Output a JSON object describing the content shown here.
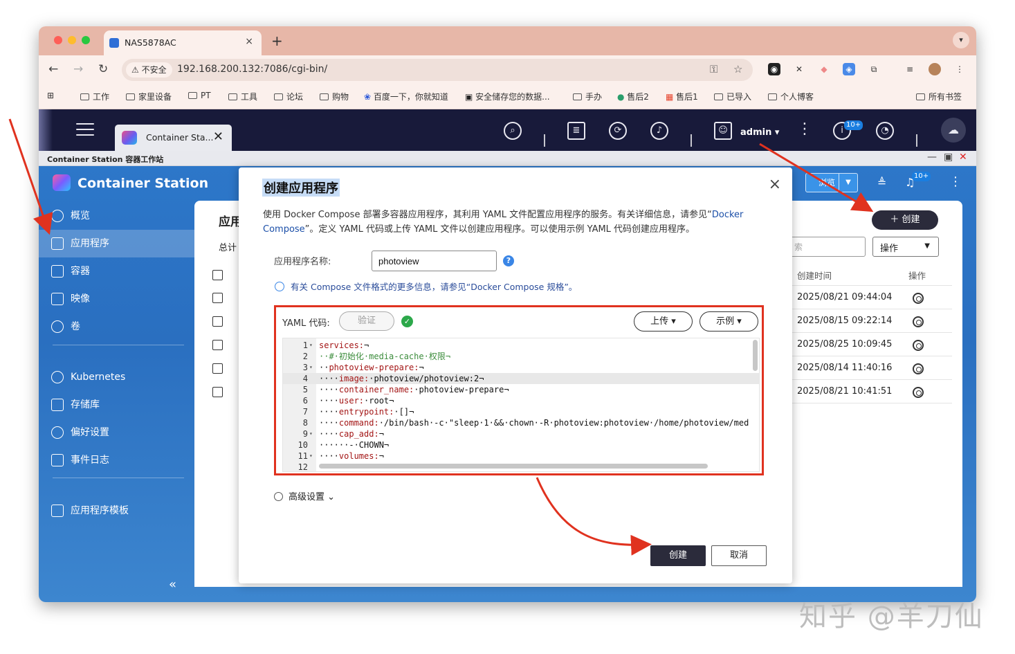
{
  "browser": {
    "tab_title": "NAS5878AC",
    "tab_close": "×",
    "new_tab": "+",
    "insecure_label": "不安全",
    "url": "192.168.200.132:7086/cgi-bin/",
    "bookmarks": [
      "工作",
      "家里设备",
      "PT",
      "工具",
      "论坛",
      "购物",
      "百度一下，你就知道",
      "安全储存您的数据...",
      "手办",
      "售后2",
      "售后1",
      "已导入",
      "个人博客",
      "所有书签"
    ]
  },
  "qts": {
    "app_tab_label": "Container Sta...",
    "app_tab_close": "✕",
    "user": "admin ▾",
    "notif_badge": "10+"
  },
  "window_strip": {
    "title": "Container Station 容器工作站"
  },
  "app": {
    "brand": "Container Station",
    "sidebar": [
      {
        "label": "概览"
      },
      {
        "label": "应用程序"
      },
      {
        "label": "容器"
      },
      {
        "label": "映像"
      },
      {
        "label": "卷"
      },
      {
        "label": "Kubernetes"
      },
      {
        "label": "存储库"
      },
      {
        "label": "偏好设置"
      },
      {
        "label": "事件日志"
      },
      {
        "label": "应用程序模板"
      }
    ],
    "collapse": "«",
    "main_title": "应用",
    "main_total": "总计",
    "browse_label": "浏览",
    "header_badge": "10+",
    "create_button": "＋ 创建",
    "search_placeholder": "索",
    "ops_select": "操作",
    "col_created": "创建时间",
    "col_ops": "操作",
    "rows": [
      {
        "created": "2025/08/21 09:44:04"
      },
      {
        "created": "2025/08/15 09:22:14"
      },
      {
        "created": "2025/08/25 10:09:45"
      },
      {
        "created": "2025/08/14 11:40:16"
      },
      {
        "created": "2025/08/21 10:41:51"
      }
    ]
  },
  "modal": {
    "title": "创建应用程序",
    "close": "×",
    "desc_before": "使用 Docker Compose 部署多容器应用程序，其利用 YAML 文件配置应用程序的服务。有关详细信息，请参见“",
    "desc_link": "Docker Compose",
    "desc_after": "”。定义 YAML 代码或上传 YAML 文件以创建应用程序。可以使用示例 YAML 代码创建应用程序。",
    "name_label": "应用程序名称:",
    "name_value": "photoview",
    "help": "?",
    "info_text": "有关 Compose 文件格式的更多信息，请参见“Docker Compose 规格”。",
    "yaml_label": "YAML 代码:",
    "verify_label": "验证",
    "upload_label": "上传 ▾",
    "example_label": "示例 ▾",
    "code_lines": [
      {
        "n": "1",
        "fold": "▾",
        "text": "services:¬"
      },
      {
        "n": "2",
        "fold": "",
        "text": "··#·初始化·media-cache·权限¬"
      },
      {
        "n": "3",
        "fold": "▾",
        "text": "··photoview-prepare:¬"
      },
      {
        "n": "4",
        "fold": "",
        "text": "····image:·photoview/photoview:2¬"
      },
      {
        "n": "5",
        "fold": "",
        "text": "····container_name:·photoview-prepare¬"
      },
      {
        "n": "6",
        "fold": "",
        "text": "····user:·root¬"
      },
      {
        "n": "7",
        "fold": "",
        "text": "····entrypoint:·[]¬"
      },
      {
        "n": "8",
        "fold": "",
        "text": "····command:·/bin/bash·-c·\"sleep·1·&&·chown·-R·photoview:photoview·/home/photoview/med"
      },
      {
        "n": "9",
        "fold": "▾",
        "text": "····cap_add:¬"
      },
      {
        "n": "10",
        "fold": "",
        "text": "······-·CHOWN¬"
      },
      {
        "n": "11",
        "fold": "▾",
        "text": "····volumes:¬"
      },
      {
        "n": "12",
        "fold": "",
        "text": ""
      }
    ],
    "advanced_label": "高级设置",
    "create_label": "创建",
    "cancel_label": "取消"
  },
  "watermark": "知乎 @羊刀仙",
  "colors": {
    "annotation_red": "#e0321f",
    "accent_blue": "#2d77c9",
    "dark_button": "#2b2b3b"
  }
}
